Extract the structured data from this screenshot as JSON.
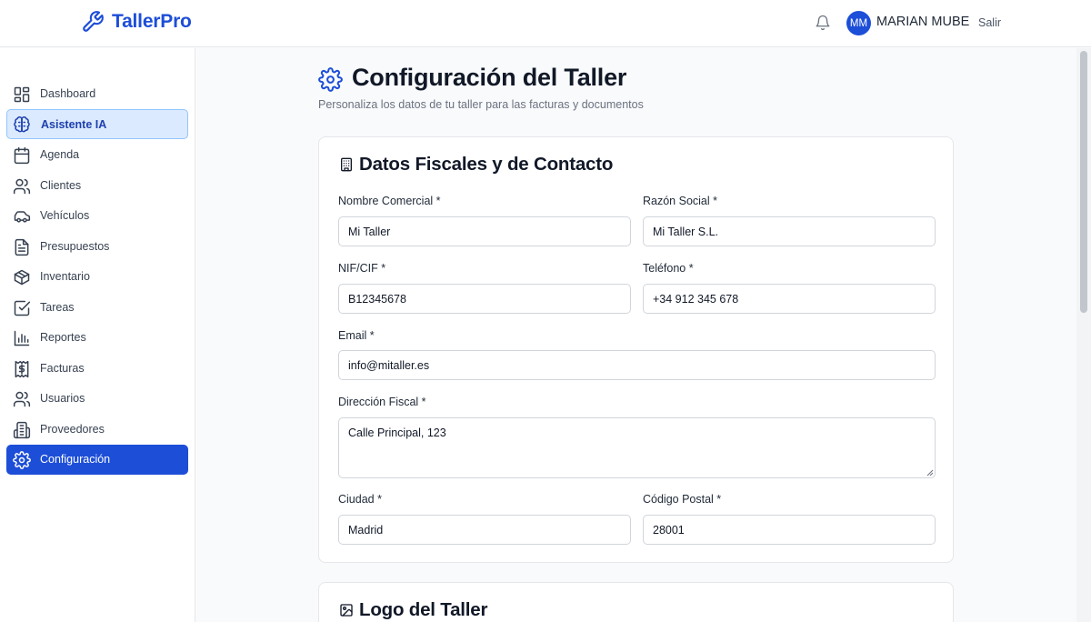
{
  "app": {
    "brand": "TallerPro",
    "brand_color": "#1d4ed8"
  },
  "header": {
    "notifications_icon": "bell-icon",
    "user": {
      "initials": "MM",
      "name": "MARIAN MUBE"
    },
    "logout_label": "Salir"
  },
  "sidebar": {
    "items": [
      {
        "label": "Dashboard",
        "icon": "dashboard-icon"
      },
      {
        "label": "Asistente IA",
        "icon": "brain-icon",
        "highlighted": true
      },
      {
        "label": "Agenda",
        "icon": "calendar-icon"
      },
      {
        "label": "Clientes",
        "icon": "users-icon"
      },
      {
        "label": "Vehículos",
        "icon": "car-icon"
      },
      {
        "label": "Presupuestos",
        "icon": "document-icon"
      },
      {
        "label": "Inventario",
        "icon": "box-icon"
      },
      {
        "label": "Tareas",
        "icon": "checkbox-icon"
      },
      {
        "label": "Reportes",
        "icon": "bar-chart-icon"
      },
      {
        "label": "Facturas",
        "icon": "invoice-icon"
      },
      {
        "label": "Usuarios",
        "icon": "users-icon"
      },
      {
        "label": "Proveedores",
        "icon": "building-icon"
      },
      {
        "label": "Configuración",
        "icon": "gear-icon",
        "active": true
      }
    ]
  },
  "page": {
    "title": "Configuración del Taller",
    "subtitle": "Personaliza los datos de tu taller para las facturas y documentos"
  },
  "fiscal_section": {
    "title": "Datos Fiscales y de Contacto",
    "fields": {
      "nombre_comercial": {
        "label": "Nombre Comercial *",
        "value": "Mi Taller"
      },
      "razon_social": {
        "label": "Razón Social *",
        "value": "Mi Taller S.L."
      },
      "nif": {
        "label": "NIF/CIF *",
        "value": "B12345678"
      },
      "telefono": {
        "label": "Teléfono *",
        "value": "+34 912 345 678"
      },
      "email": {
        "label": "Email *",
        "value": "info@mitaller.es"
      },
      "direccion": {
        "label": "Dirección Fiscal *",
        "value": "Calle Principal, 123"
      },
      "ciudad": {
        "label": "Ciudad *",
        "value": "Madrid"
      },
      "codigo_postal": {
        "label": "Código Postal *",
        "value": "28001"
      }
    }
  },
  "logo_section": {
    "title": "Logo del Taller"
  }
}
